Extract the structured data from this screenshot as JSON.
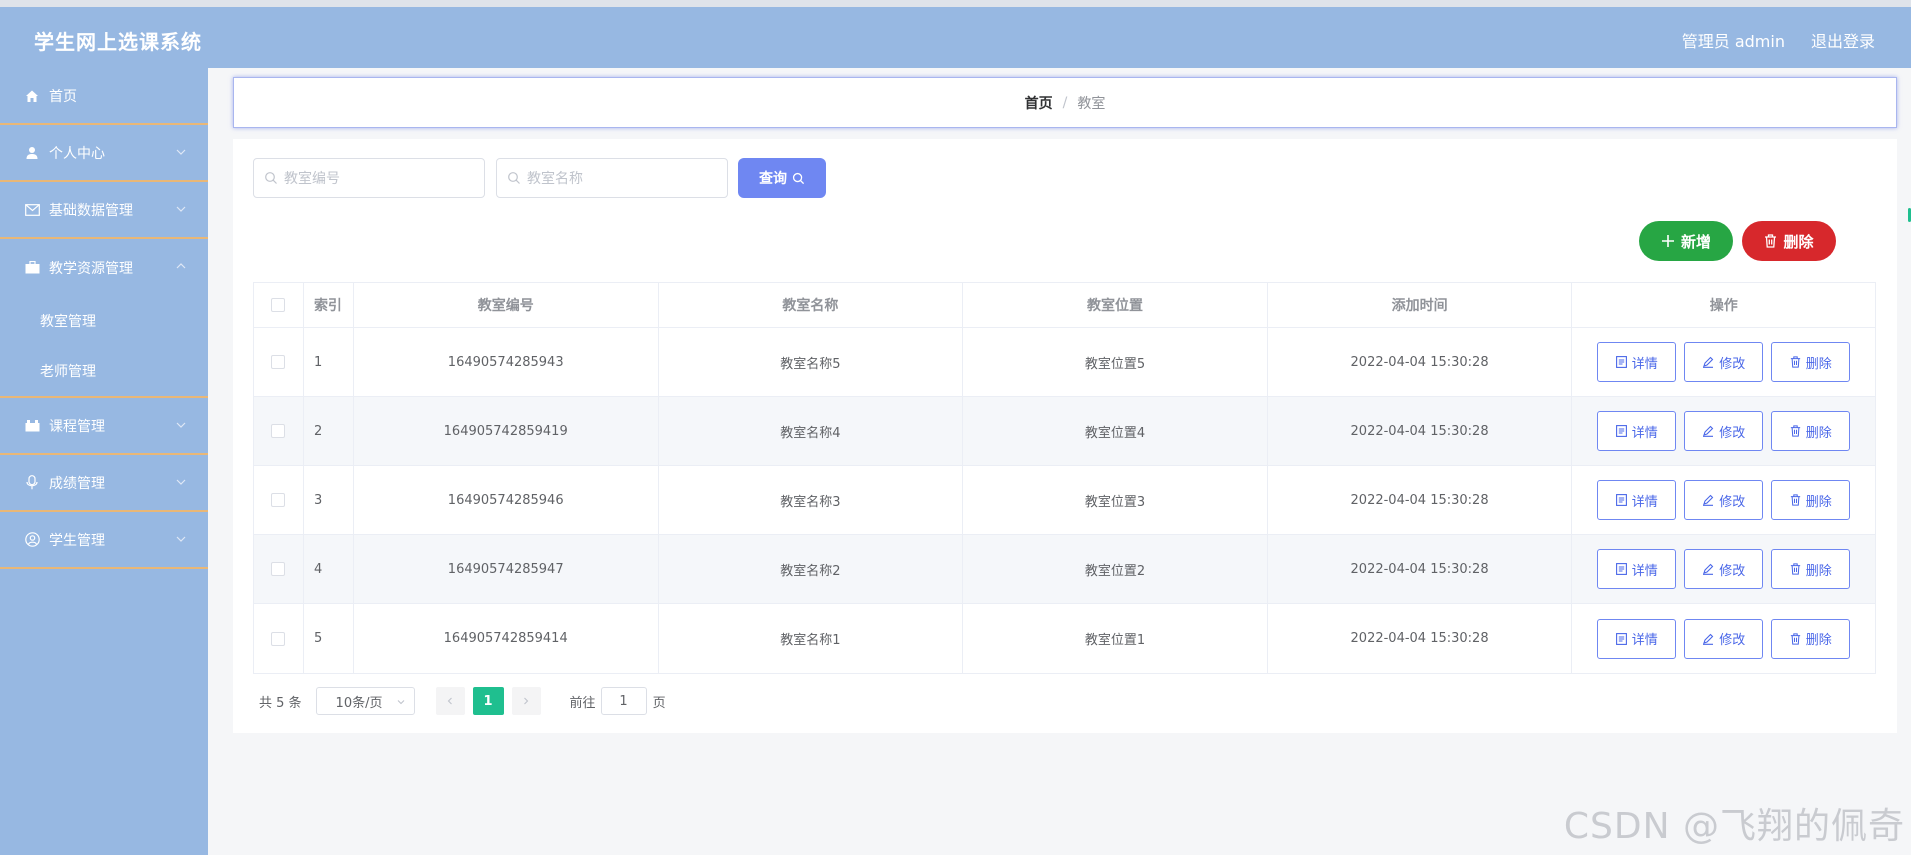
{
  "app": {
    "title": "学生网上选课系统"
  },
  "header": {
    "user": "管理员 admin",
    "logout": "退出登录"
  },
  "sidebar": {
    "items": [
      {
        "label": "首页",
        "icon": "home-icon",
        "expandable": false
      },
      {
        "label": "个人中心",
        "icon": "user-icon",
        "expandable": true
      },
      {
        "label": "基础数据管理",
        "icon": "mail-icon",
        "expandable": true
      },
      {
        "label": "教学资源管理",
        "icon": "briefcase-icon",
        "expandable": true,
        "children": [
          "教室管理",
          "老师管理"
        ]
      },
      {
        "label": "课程管理",
        "icon": "suitcase-icon",
        "expandable": true
      },
      {
        "label": "成绩管理",
        "icon": "mic-icon",
        "expandable": true
      },
      {
        "label": "学生管理",
        "icon": "circle-user-icon",
        "expandable": true
      }
    ]
  },
  "breadcrumb": {
    "home": "首页",
    "separator": "/",
    "current": "教室"
  },
  "search": {
    "number_placeholder": "教室编号",
    "name_placeholder": "教室名称",
    "query_label": "查询"
  },
  "actions": {
    "add_label": "新增",
    "delete_label": "删除"
  },
  "table": {
    "headers": [
      "索引",
      "教室编号",
      "教室名称",
      "教室位置",
      "添加时间",
      "操作"
    ],
    "rows": [
      {
        "index": "1",
        "number": "16490574285943",
        "name": "教室名称5",
        "location": "教室位置5",
        "time": "2022-04-04 15:30:28"
      },
      {
        "index": "2",
        "number": "164905742859419",
        "name": "教室名称4",
        "location": "教室位置4",
        "time": "2022-04-04 15:30:28"
      },
      {
        "index": "3",
        "number": "16490574285946",
        "name": "教室名称3",
        "location": "教室位置3",
        "time": "2022-04-04 15:30:28"
      },
      {
        "index": "4",
        "number": "16490574285947",
        "name": "教室名称2",
        "location": "教室位置2",
        "time": "2022-04-04 15:30:28"
      },
      {
        "index": "5",
        "number": "164905742859414",
        "name": "教室名称1",
        "location": "教室位置1",
        "time": "2022-04-04 15:30:28"
      }
    ],
    "row_actions": {
      "detail": "详情",
      "edit": "修改",
      "delete": "删除"
    }
  },
  "pagination": {
    "total": "共 5 条",
    "page_size": "10条/页",
    "current_page": "1",
    "goto_prefix": "前往",
    "goto_value": "1",
    "goto_suffix": "页"
  },
  "watermark": "CSDN @飞翔的佩奇",
  "colors": {
    "header_bg": "#97b8e2",
    "sidebar_bg": "#97b8e2",
    "sidebar_divider": "#e9b777",
    "query_btn": "#6f87f2",
    "add_btn": "#27a644",
    "delete_btn": "#d7282c",
    "pager_active": "#1fbf8f"
  }
}
